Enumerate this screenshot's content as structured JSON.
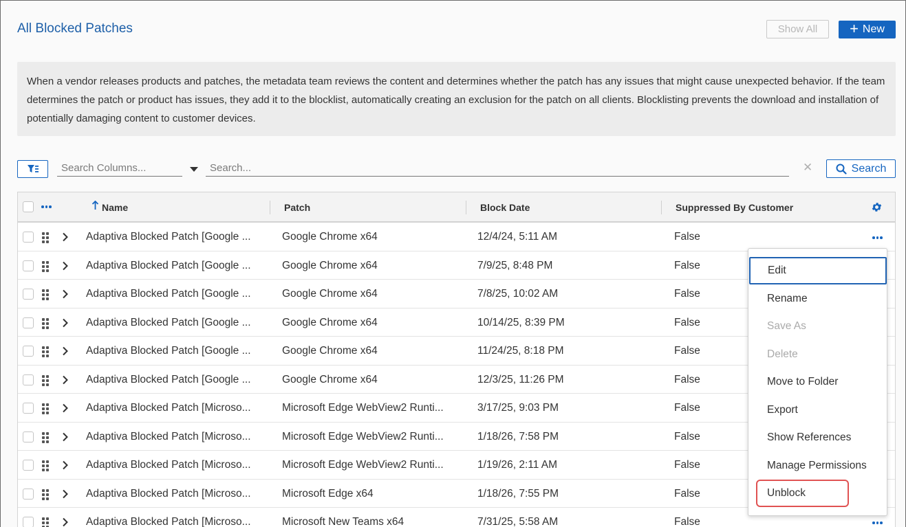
{
  "page": {
    "title": "All Blocked Patches",
    "show_all_label": "Show All",
    "new_label": "New",
    "info_text": "When a vendor releases products and patches, the metadata team reviews the content and determines whether the patch has any issues that might cause unexpected behavior. If the team determines the patch or product has issues, they add it to the blocklist, automatically creating an exclusion for the patch on all clients. Blocklisting prevents the download and installation of potentially damaging content to customer devices."
  },
  "toolbar": {
    "search_columns_placeholder": "Search Columns...",
    "search_placeholder": "Search...",
    "search_button": "Search"
  },
  "grid": {
    "columns": {
      "name": "Name",
      "patch": "Patch",
      "block_date": "Block Date",
      "suppressed": "Suppressed By Customer"
    },
    "rows": [
      {
        "name": "Adaptiva Blocked Patch [Google ...",
        "patch": "Google Chrome x64",
        "date": "12/4/24, 5:11 AM",
        "suppressed": "False"
      },
      {
        "name": "Adaptiva Blocked Patch [Google ...",
        "patch": "Google Chrome x64",
        "date": "7/9/25, 8:48 PM",
        "suppressed": "False"
      },
      {
        "name": "Adaptiva Blocked Patch [Google ...",
        "patch": "Google Chrome x64",
        "date": "7/8/25, 10:02 AM",
        "suppressed": "False"
      },
      {
        "name": "Adaptiva Blocked Patch [Google ...",
        "patch": "Google Chrome x64",
        "date": "10/14/25, 8:39 PM",
        "suppressed": "False"
      },
      {
        "name": "Adaptiva Blocked Patch [Google ...",
        "patch": "Google Chrome x64",
        "date": "11/24/25, 8:18 PM",
        "suppressed": "False"
      },
      {
        "name": "Adaptiva Blocked Patch [Google ...",
        "patch": "Google Chrome x64",
        "date": "12/3/25, 11:26 PM",
        "suppressed": "False"
      },
      {
        "name": "Adaptiva Blocked Patch [Microso...",
        "patch": "Microsoft Edge WebView2 Runti...",
        "date": "3/17/25, 9:03 PM",
        "suppressed": "False"
      },
      {
        "name": "Adaptiva Blocked Patch [Microso...",
        "patch": "Microsoft Edge WebView2 Runti...",
        "date": "1/18/26, 7:58 PM",
        "suppressed": "False"
      },
      {
        "name": "Adaptiva Blocked Patch [Microso...",
        "patch": "Microsoft Edge WebView2 Runti...",
        "date": "1/19/26, 2:11 AM",
        "suppressed": "False"
      },
      {
        "name": "Adaptiva Blocked Patch [Microso...",
        "patch": "Microsoft Edge x64",
        "date": "1/18/26, 7:55 PM",
        "suppressed": "False"
      },
      {
        "name": "Adaptiva Blocked Patch [Microso...",
        "patch": "Microsoft New Teams x64",
        "date": "7/31/25, 5:58 AM",
        "suppressed": "False"
      }
    ]
  },
  "context_menu": {
    "items": [
      {
        "label": "Edit",
        "state": "focused"
      },
      {
        "label": "Rename",
        "state": "enabled"
      },
      {
        "label": "Save As",
        "state": "disabled"
      },
      {
        "label": "Delete",
        "state": "disabled"
      },
      {
        "label": "Move to Folder",
        "state": "enabled"
      },
      {
        "label": "Export",
        "state": "enabled"
      },
      {
        "label": "Show References",
        "state": "enabled"
      },
      {
        "label": "Manage Permissions",
        "state": "enabled"
      },
      {
        "label": "Unblock",
        "state": "enabled"
      }
    ]
  },
  "icons": {
    "filter": "filter-icon",
    "search": "search-icon",
    "clear": "clear-icon",
    "settings": "gear-icon",
    "sort": "sort-ascending-icon",
    "drag": "drag-handle-icon",
    "expand": "chevron-right-icon",
    "more": "more-options-icon"
  },
  "colors": {
    "accent": "#1565c0",
    "title": "#1d5fa8",
    "highlight": "#e05252"
  }
}
